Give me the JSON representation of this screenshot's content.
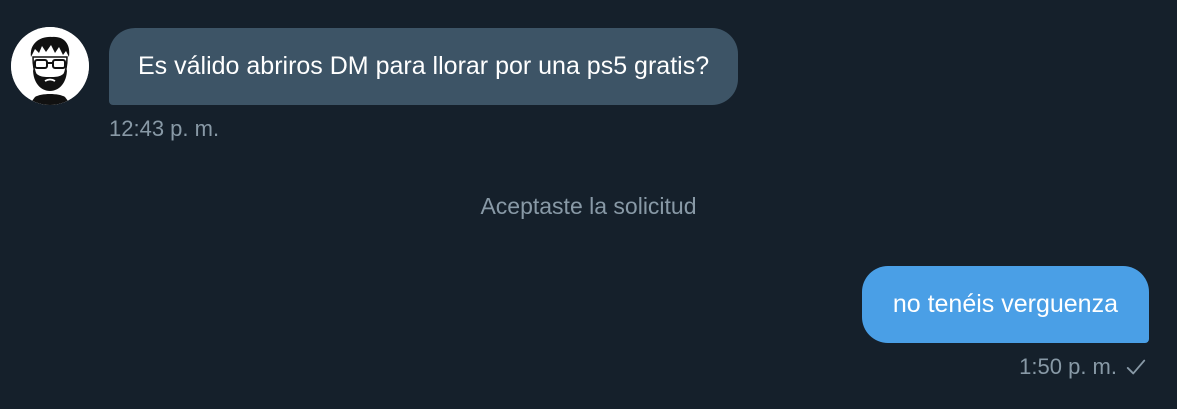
{
  "incoming": {
    "avatar_icon": "bearded-man-with-glasses-avatar-icon",
    "text": "Es válido abriros DM para llorar por una ps5 gratis?",
    "time": "12:43 p. m."
  },
  "system": {
    "note": "Aceptaste la solicitud"
  },
  "outgoing": {
    "text": "no tenéis verguenza",
    "time": "1:50 p. m.",
    "status_icon": "checkmark-icon"
  },
  "colors": {
    "background": "#15202b",
    "incoming_bubble": "#3d5466",
    "outgoing_bubble": "#4a9fe6",
    "muted_text": "#8899a6"
  }
}
